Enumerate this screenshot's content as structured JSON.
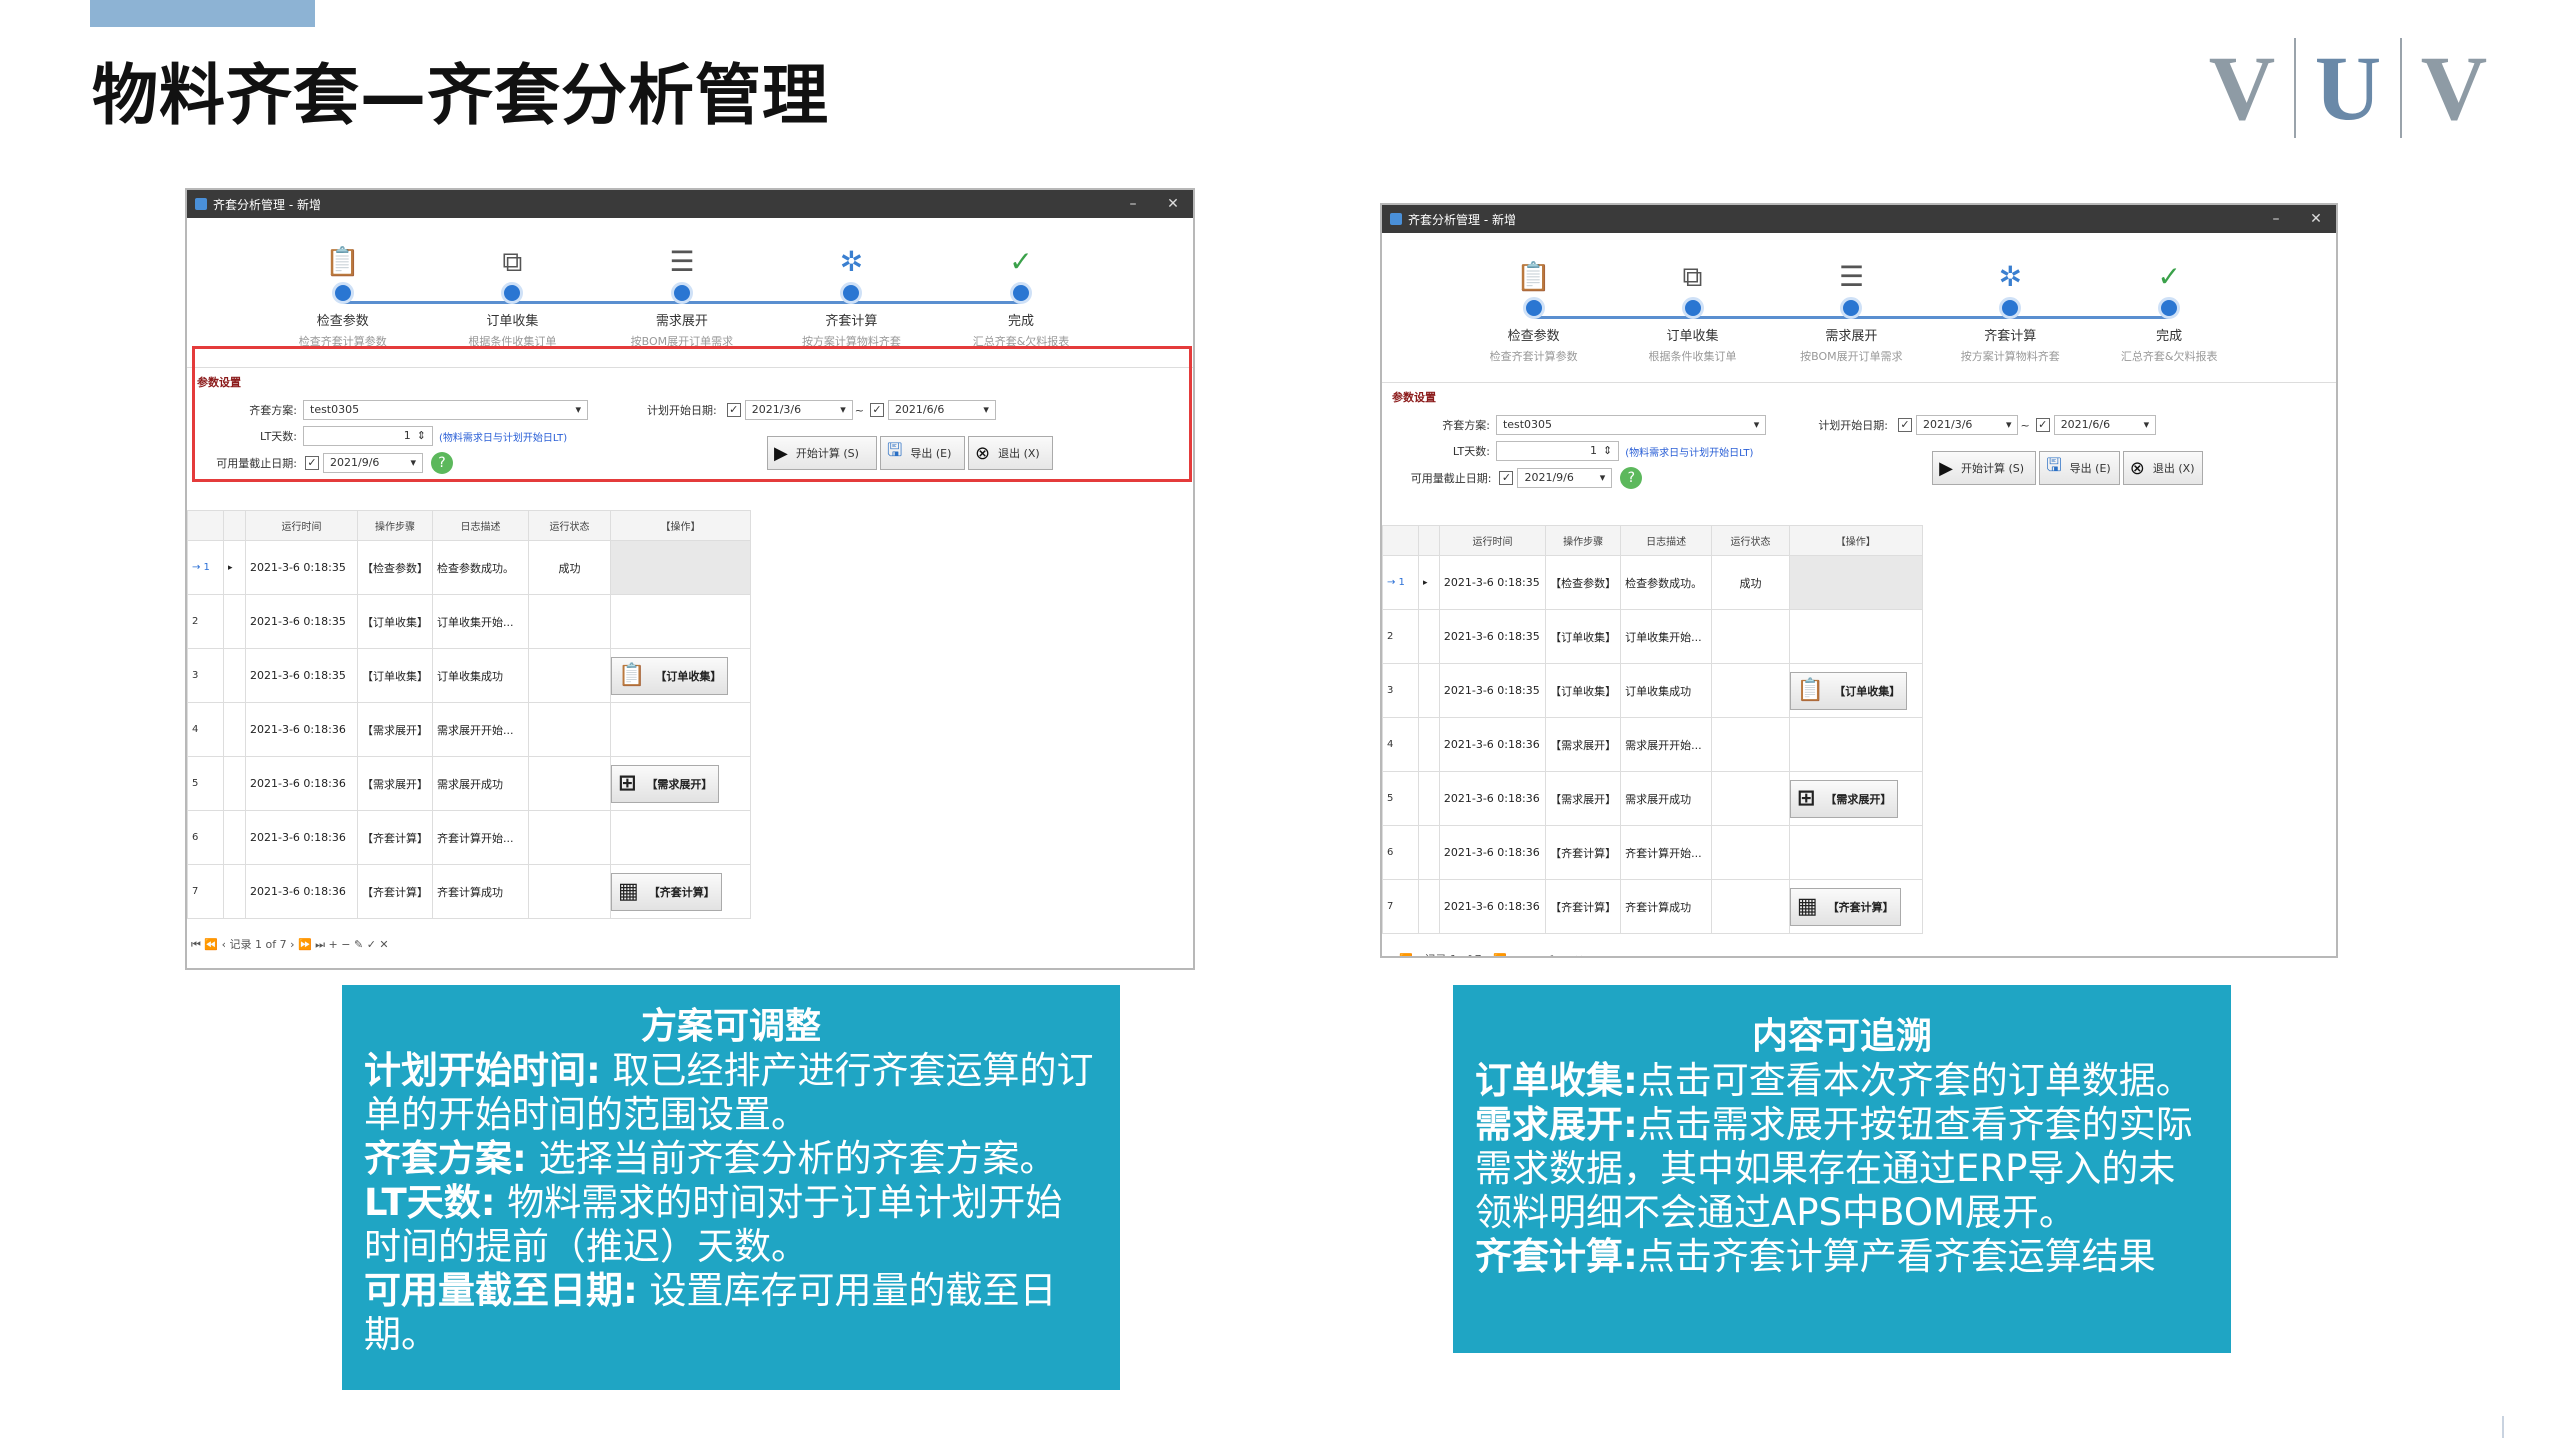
{
  "page": {
    "title": "物料齐套—齐套分析管理",
    "logo": [
      "V",
      "U",
      "V"
    ]
  },
  "window": {
    "title": "齐套分析管理 - 新增",
    "min": "–",
    "close": "✕",
    "steps": [
      {
        "name": "检查参数",
        "desc": "检查齐套计算参数",
        "icon": "checklist-icon"
      },
      {
        "name": "订单收集",
        "desc": "根据条件收集订单",
        "icon": "copy-icon"
      },
      {
        "name": "需求展开",
        "desc": "按BOM展开订单需求",
        "icon": "expand-list-icon"
      },
      {
        "name": "齐套计算",
        "desc": "按方案计算物料齐套",
        "icon": "loading-icon"
      },
      {
        "name": "完成",
        "desc": "汇总齐套&欠料报表",
        "icon": "check-icon"
      }
    ],
    "params": {
      "section_title": "参数设置",
      "scheme_label": "齐套方案:",
      "scheme_value": "test0305",
      "lt_label": "LT天数:",
      "lt_value": "1",
      "lt_hint": "(物料需求日与计划开始日LT)",
      "avail_label": "可用量截止日期:",
      "avail_date": "2021/9/6",
      "plan_label": "计划开始日期:",
      "plan_from": "2021/3/6",
      "plan_sep": "~",
      "plan_to": "2021/6/6",
      "btn_start": "开始计算 (S)",
      "btn_export": "导出 (E)",
      "btn_exit": "退出 (X)"
    },
    "grid": {
      "headers": [
        "运行时间",
        "操作步骤",
        "日志描述",
        "运行状态",
        "【操作】"
      ],
      "rows": [
        {
          "no": "→ 1",
          "time": "2021-3-6 0:18:35",
          "step": "【检查参数】",
          "desc": "检查参数成功。",
          "status": "成功",
          "action": ""
        },
        {
          "no": "2",
          "time": "2021-3-6 0:18:35",
          "step": "【订单收集】",
          "desc": "订单收集开始...",
          "status": "",
          "action": ""
        },
        {
          "no": "3",
          "time": "2021-3-6 0:18:35",
          "step": "【订单收集】",
          "desc": "订单收集成功",
          "status": "",
          "action": "【订单收集】"
        },
        {
          "no": "4",
          "time": "2021-3-6 0:18:36",
          "step": "【需求展开】",
          "desc": "需求展开开始...",
          "status": "",
          "action": ""
        },
        {
          "no": "5",
          "time": "2021-3-6 0:18:36",
          "step": "【需求展开】",
          "desc": "需求展开成功",
          "status": "",
          "action": "【需求展开】"
        },
        {
          "no": "6",
          "time": "2021-3-6 0:18:36",
          "step": "【齐套计算】",
          "desc": "齐套计算开始...",
          "status": "",
          "action": ""
        },
        {
          "no": "7",
          "time": "2021-3-6 0:18:36",
          "step": "【齐套计算】",
          "desc": "齐套计算成功",
          "status": "",
          "action": "【齐套计算】"
        }
      ],
      "nav": "⏮ ⏪ ‹  记录 1 of 7  › ⏩ ⏭ + − ✎ ✓ ✕"
    }
  },
  "callout_left": {
    "heading": "方案可调整",
    "items": [
      {
        "label": "计划开始时间:",
        "text": "  取已经排产进行齐套运算的订单的开始时间的范围设置。"
      },
      {
        "label": "齐套方案:",
        "text": "  选择当前齐套分析的齐套方案。"
      },
      {
        "label": " LT天数:",
        "text": "      物料需求的时间对于订单计划开始时间的提前（推迟）天数。"
      },
      {
        "label": "可用量截至日期:",
        "text": "  设置库存可用量的截至日期。"
      }
    ]
  },
  "callout_right": {
    "heading": "内容可追溯",
    "items": [
      {
        "label": "订单收集:",
        "text": "点击可查看本次齐套的订单数据。"
      },
      {
        "label": "需求展开:",
        "text": "点击需求展开按钮查看齐套的实际需求数据，其中如果存在通过ERP导入的未领料明细不会通过APS中BOM展开。"
      },
      {
        "label": "齐套计算:",
        "text": "点击齐套计算产看齐套运算结果"
      }
    ]
  }
}
